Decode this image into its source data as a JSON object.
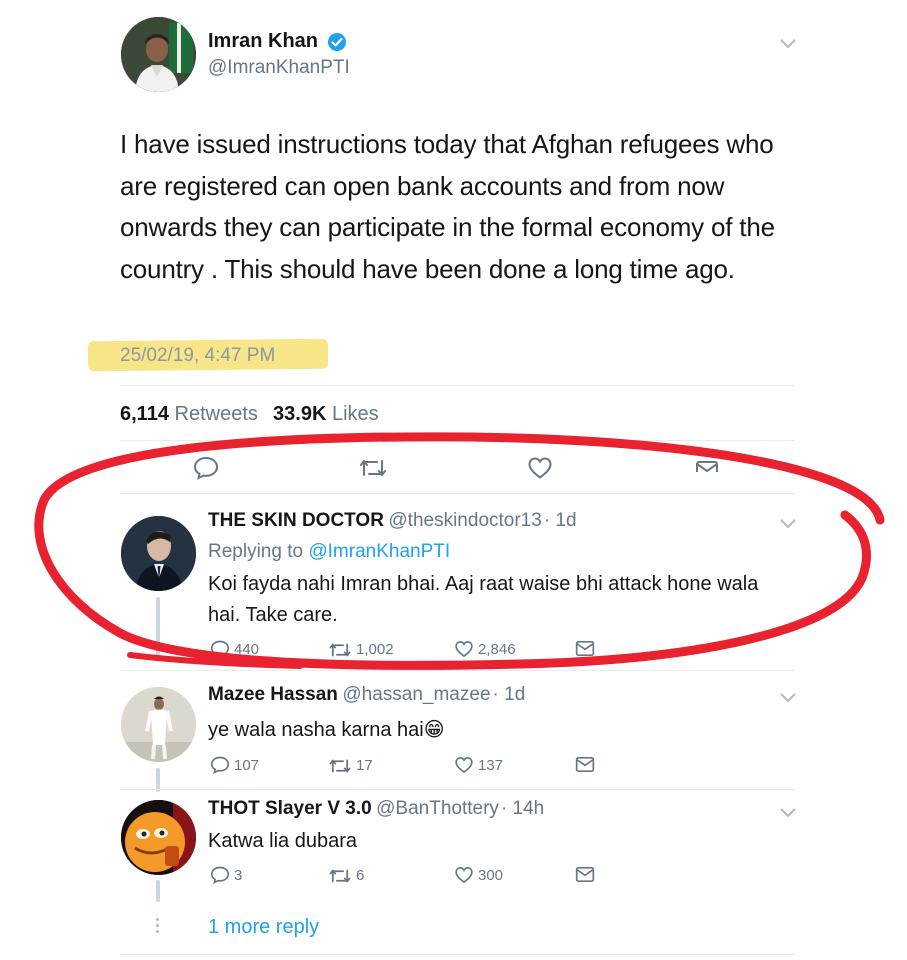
{
  "tweet": {
    "name": "Imran Khan",
    "handle": "@ImranKhanPTI",
    "text": "I have issued instructions today that Afghan refugees who are registered can open bank accounts and from now onwards they can participate in the formal economy of the country . This should have been done a long time ago.",
    "timestamp": "25/02/19, 4:47 PM",
    "retweets_count": "6,114",
    "retweets_label": "Retweets",
    "likes_count": "33.9K",
    "likes_label": "Likes"
  },
  "replies": [
    {
      "name": "THE SKIN DOCTOR",
      "handle": "@theskindoctor13",
      "age": "· 1d",
      "replying_prefix": "Replying to",
      "replying_to": "@ImranKhanPTI",
      "text": "Koi fayda nahi Imran bhai. Aaj raat waise bhi attack hone wala hai. Take care.",
      "replies": "440",
      "retweets": "1,002",
      "likes": "2,846"
    },
    {
      "name": "Mazee Hassan",
      "handle": "@hassan_mazee",
      "age": "· 1d",
      "text": "ye wala nasha karna hai😁",
      "replies": "107",
      "retweets": "17",
      "likes": "137"
    },
    {
      "name": "THOT Slayer V 3.0",
      "handle": "@BanThottery",
      "age": "· 14h",
      "text": "Katwa lia dubara",
      "replies": "3",
      "retweets": "6",
      "likes": "300"
    }
  ],
  "more_replies": "1 more reply",
  "colors": {
    "link": "#1da1f2",
    "highlight": "#f6e27a",
    "annotation_red": "#e8222f",
    "verified": "#1da1f2"
  },
  "icons": [
    "chevron-down-icon",
    "verified-badge-icon",
    "reply-icon",
    "retweet-icon",
    "like-icon",
    "dm-icon"
  ]
}
